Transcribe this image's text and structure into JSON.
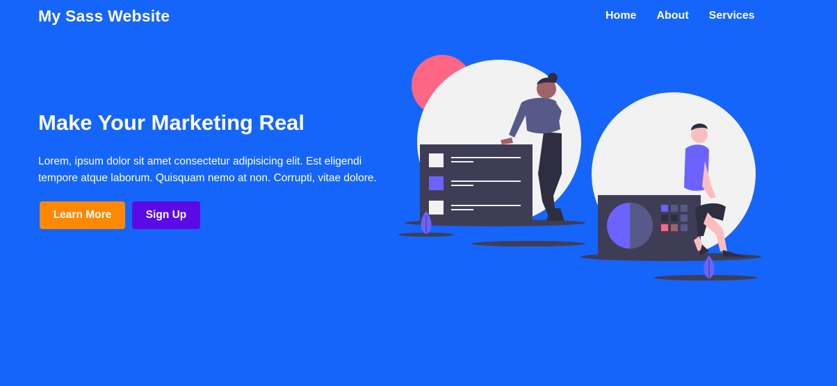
{
  "header": {
    "logo": "My Sass Website",
    "nav": [
      "Home",
      "About",
      "Services"
    ]
  },
  "hero": {
    "title": "Make Your Marketing Real",
    "description_line1": "Lorem, ipsum dolor sit amet consectetur adipisicing elit. Est eligendi",
    "description_line2": "tempore atque laborum. Quisquam nemo at non. Corrupti, vitae dolore.",
    "learn_more_label": "Learn More",
    "sign_up_label": "Sign Up"
  },
  "colors": {
    "background": "#1565fb",
    "learn_more_button": "#ff8800",
    "sign_up_button": "#5b0ae6",
    "accent_pink": "#ff6584",
    "accent_purple": "#6c63ff",
    "panel_dark": "#3f3d56",
    "circle_light": "#f2f2f2"
  },
  "illustration": {
    "icon": "marketing-illustration"
  }
}
